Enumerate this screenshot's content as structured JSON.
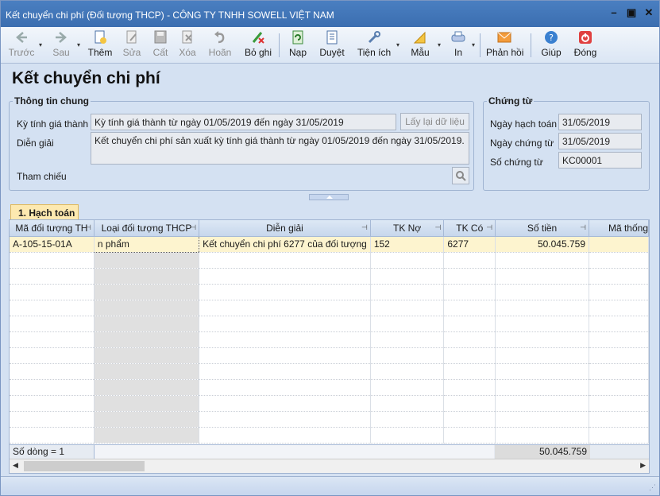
{
  "window": {
    "title": "Kết chuyển chi phí (Đối tượng THCP) - CÔNG TY TNHH SOWELL VIỆT NAM"
  },
  "toolbar": {
    "prev": "Trước",
    "next": "Sau",
    "add": "Thêm",
    "edit": "Sửa",
    "save": "Cất",
    "delete": "Xóa",
    "undo": "Hoãn",
    "unpost": "Bỏ ghi",
    "reload": "Nạp",
    "approve": "Duyệt",
    "utilities": "Tiện ích",
    "template": "Mẫu",
    "print": "In",
    "feedback": "Phản hồi",
    "help": "Giúp",
    "close": "Đóng"
  },
  "page": {
    "title": "Kết chuyển chi phí"
  },
  "general": {
    "legend": "Thông tin chung",
    "period_label": "Kỳ tính giá thành",
    "period_value": "Kỳ tính giá thành từ ngày 01/05/2019 đến ngày 31/05/2019",
    "reload_button": "Lấy lại dữ liệu",
    "desc_label": "Diễn giải",
    "desc_value": "Kết chuyển chi phí sản xuất kỳ tính giá thành từ ngày 01/05/2019 đến ngày 31/05/2019.",
    "ref_label": "Tham chiếu"
  },
  "voucher": {
    "legend": "Chứng từ",
    "post_date_label": "Ngày hạch toán",
    "post_date_value": "31/05/2019",
    "doc_date_label": "Ngày chứng từ",
    "doc_date_value": "31/05/2019",
    "doc_no_label": "Số chứng từ",
    "doc_no_value": "KC00001"
  },
  "tab": {
    "label": "1. Hạch toán"
  },
  "grid": {
    "columns": [
      "Mã đối tượng TH",
      "Loại đối tượng THCP",
      "Diễn giải",
      "TK Nợ",
      "TK Có",
      "Số tiền",
      "Mã thống"
    ],
    "row": {
      "code": "A-105-15-01A",
      "type": "n phẩm",
      "desc": "Kết chuyển chi phí 6277 của đối tượng",
      "debit": "152",
      "credit": "6277",
      "amount": "50.045.759"
    },
    "footer_count": "Số dòng = 1",
    "footer_total": "50.045.759"
  }
}
